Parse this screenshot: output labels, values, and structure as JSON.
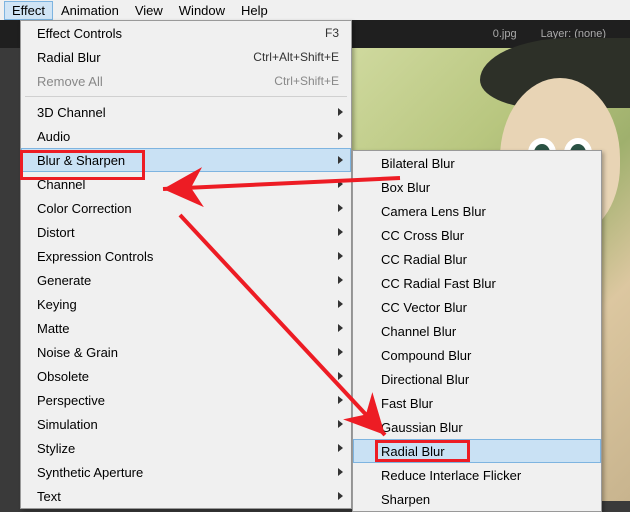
{
  "menubar": {
    "items": [
      {
        "label": "Effect",
        "active": true
      },
      {
        "label": "Animation"
      },
      {
        "label": "View"
      },
      {
        "label": "Window"
      },
      {
        "label": "Help"
      }
    ]
  },
  "darkbar": {
    "tab": "0.jpg",
    "layer": "Layer: (none)"
  },
  "effect_menu": [
    {
      "label": "Effect Controls",
      "shortcut": "F3"
    },
    {
      "label": "Radial Blur",
      "shortcut": "Ctrl+Alt+Shift+E"
    },
    {
      "label": "Remove All",
      "shortcut": "Ctrl+Shift+E",
      "disabled": true
    },
    {
      "sep": true
    },
    {
      "label": "3D Channel",
      "arrow": true
    },
    {
      "label": "Audio",
      "arrow": true
    },
    {
      "label": "Blur & Sharpen",
      "arrow": true,
      "highlighted": true
    },
    {
      "label": "Channel",
      "arrow": true
    },
    {
      "label": "Color Correction",
      "arrow": true
    },
    {
      "label": "Distort",
      "arrow": true
    },
    {
      "label": "Expression Controls",
      "arrow": true
    },
    {
      "label": "Generate",
      "arrow": true
    },
    {
      "label": "Keying",
      "arrow": true
    },
    {
      "label": "Matte",
      "arrow": true
    },
    {
      "label": "Noise & Grain",
      "arrow": true
    },
    {
      "label": "Obsolete",
      "arrow": true
    },
    {
      "label": "Perspective",
      "arrow": true
    },
    {
      "label": "Simulation",
      "arrow": true
    },
    {
      "label": "Stylize",
      "arrow": true
    },
    {
      "label": "Synthetic Aperture",
      "arrow": true
    },
    {
      "label": "Text",
      "arrow": true
    }
  ],
  "blur_submenu": [
    {
      "label": "Bilateral Blur"
    },
    {
      "label": "Box Blur"
    },
    {
      "label": "Camera Lens Blur"
    },
    {
      "label": "CC Cross Blur"
    },
    {
      "label": "CC Radial Blur"
    },
    {
      "label": "CC Radial Fast Blur"
    },
    {
      "label": "CC Vector Blur"
    },
    {
      "label": "Channel Blur"
    },
    {
      "label": "Compound Blur"
    },
    {
      "label": "Directional Blur"
    },
    {
      "label": "Fast Blur"
    },
    {
      "label": "Gaussian Blur"
    },
    {
      "label": "Radial Blur",
      "highlighted": true
    },
    {
      "label": "Reduce Interlace Flicker"
    },
    {
      "label": "Sharpen"
    }
  ],
  "annotations": {
    "arrow_color": "#ed1c24"
  }
}
